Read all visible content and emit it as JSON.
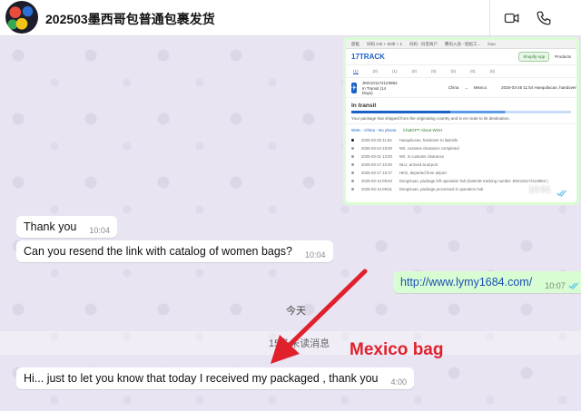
{
  "header": {
    "title": "202503墨西哥包普通包裹发货",
    "video_icon": "video-call-icon",
    "phone_icon": "phone-call-icon"
  },
  "screenshot": {
    "topbar_items": [
      "底框",
      "扫码 Ctrl + Shift + 1",
      "扫码 - 抖音商户",
      "腾讯入驻 - 轻松工...",
      "Goo"
    ],
    "logo": "17TRACK",
    "shopify": "Shopify App",
    "products": "Products",
    "tabs": [
      "(1)",
      "(0)",
      "(1)",
      "(0)",
      "(0)",
      "(0)",
      "(0)",
      "(0)"
    ],
    "tracking_no": "JMX101172123864",
    "transit_days": "In Transit (14 Days)",
    "from": "China",
    "to": "Mexico",
    "latest": "2025-03-25 11:54 Huequilucan, handover",
    "status": "In transit",
    "description": "Your package has shipped from the originating country and is en route to its destination.",
    "carrier": "WSK - China - No phone",
    "carrier_extra": "ChatGPT About WSH",
    "events": [
      {
        "time": "2025-03-25 11:54",
        "text": "Huequilucan, handover to lastmile"
      },
      {
        "time": "2025-03-24 18:00",
        "text": "MX, customs clearance completed"
      },
      {
        "time": "2025-03-21 12:00",
        "text": "MX, in customs clearance"
      },
      {
        "time": "2025-03-17 22:00",
        "text": "NLU, arrived at airport"
      },
      {
        "time": "2025-03-17 10:17",
        "text": "HKG, departed from airport"
      },
      {
        "time": "2025-03-13 09:53",
        "text": "DongGuan, package left operation hub (lastmile tracking number JMX101172123864 )"
      },
      {
        "time": "2025-03-13 08:51",
        "text": "DongGuan, package processed in operation hub"
      }
    ],
    "time": "10:01"
  },
  "messages": {
    "thank_you": {
      "text": "Thank you",
      "time": "10:04"
    },
    "resend": {
      "text": "Can you resend the link with catalog of women bags?",
      "time": "10:04"
    },
    "link": {
      "text": "http://www.lymy1684.com/",
      "time": "10:07"
    },
    "received": {
      "text": "Hi... just to let you know that today I received my packaged , thank you",
      "time": "4:00"
    }
  },
  "date_separator": "今天",
  "unread_label": "15条未读消息",
  "annotation": "Mexico bag",
  "colors": {
    "outgoing": "#d9fdd3",
    "incoming": "#ffffff",
    "annotation": "#e0212c",
    "ticks": "#53bdeb"
  }
}
